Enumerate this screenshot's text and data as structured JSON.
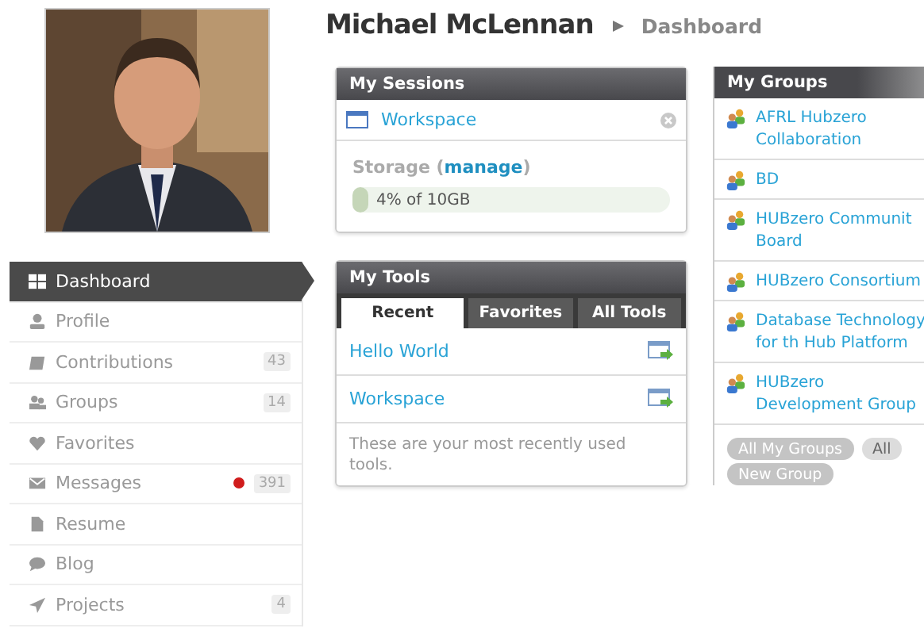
{
  "header": {
    "name": "Michael McLennan",
    "crumb": "Dashboard"
  },
  "nav": [
    {
      "label": "Dashboard",
      "selected": true
    },
    {
      "label": "Profile",
      "selected": false
    },
    {
      "label": "Contributions",
      "selected": false,
      "count": "43"
    },
    {
      "label": "Groups",
      "selected": false,
      "count": "14"
    },
    {
      "label": "Favorites",
      "selected": false
    },
    {
      "label": "Messages",
      "selected": false,
      "unread": true,
      "count": "391"
    },
    {
      "label": "Resume",
      "selected": false
    },
    {
      "label": "Blog",
      "selected": false
    },
    {
      "label": "Projects",
      "selected": false,
      "count": "4"
    }
  ],
  "sessions": {
    "title": "My Sessions",
    "items": [
      "Workspace"
    ],
    "storage_label": "Storage (",
    "storage_link": "manage",
    "storage_close": ")",
    "storage_text": "4% of 10GB",
    "level": 0.04
  },
  "tools": {
    "title": "My Tools",
    "tabs": [
      {
        "label": "Recent",
        "selected": true
      },
      {
        "label": "Favorites",
        "selected": false
      },
      {
        "label": "All Tools",
        "selected": false
      }
    ],
    "items": [
      "Hello World",
      "Workspace"
    ],
    "note": "These are your most recently used tools."
  },
  "groups": {
    "title": "My Groups",
    "items": [
      "AFRL Hubzero Collaboration",
      "BD",
      "HUBzero Communit Board",
      "HUBzero Consortium",
      "Database Technology for th Hub Platform",
      "HUBzero Development Group"
    ],
    "buttons": [
      "All My Groups",
      "All",
      "New Group"
    ]
  }
}
